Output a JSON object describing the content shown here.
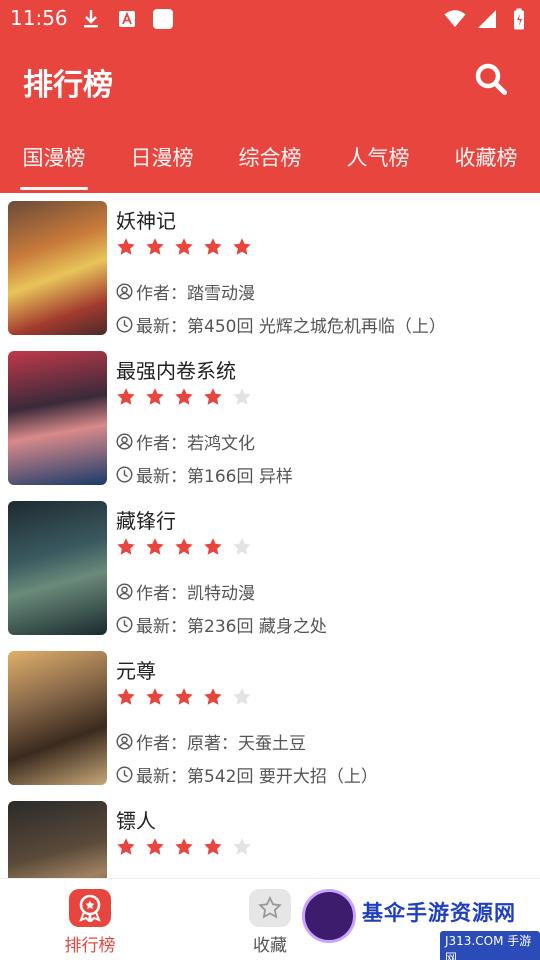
{
  "status_bar": {
    "time": "11:56"
  },
  "header": {
    "title": "排行榜",
    "accent": "#e8453f"
  },
  "tabs": [
    {
      "label": "国漫榜",
      "active": true
    },
    {
      "label": "日漫榜",
      "active": false
    },
    {
      "label": "综合榜",
      "active": false
    },
    {
      "label": "人气榜",
      "active": false
    },
    {
      "label": "收藏榜",
      "active": false
    }
  ],
  "comics": [
    {
      "title": "妖神记",
      "rating": 5,
      "author": "作者：踏雪动漫",
      "latest": "最新：第450回 光辉之城危机再临（上）"
    },
    {
      "title": "最强内卷系统",
      "rating": 4,
      "author": "作者：若鸿文化",
      "latest": "最新：第166回 异样"
    },
    {
      "title": "藏锋行",
      "rating": 4,
      "author": "作者：凯特动漫",
      "latest": "最新：第236回 藏身之处"
    },
    {
      "title": "元尊",
      "rating": 4,
      "author": "作者：原著：天蚕土豆",
      "latest": "最新：第542回 要开大招（上）"
    },
    {
      "title": "镖人",
      "rating": 4,
      "author": "",
      "latest": ""
    }
  ],
  "bottom_nav": [
    {
      "label": "排行榜",
      "icon": "ranking-icon",
      "active": true
    },
    {
      "label": "收藏",
      "icon": "star-icon",
      "active": false
    }
  ],
  "watermark": {
    "text": "基伞手游资源网",
    "sub": "J313.COM 手游网"
  }
}
